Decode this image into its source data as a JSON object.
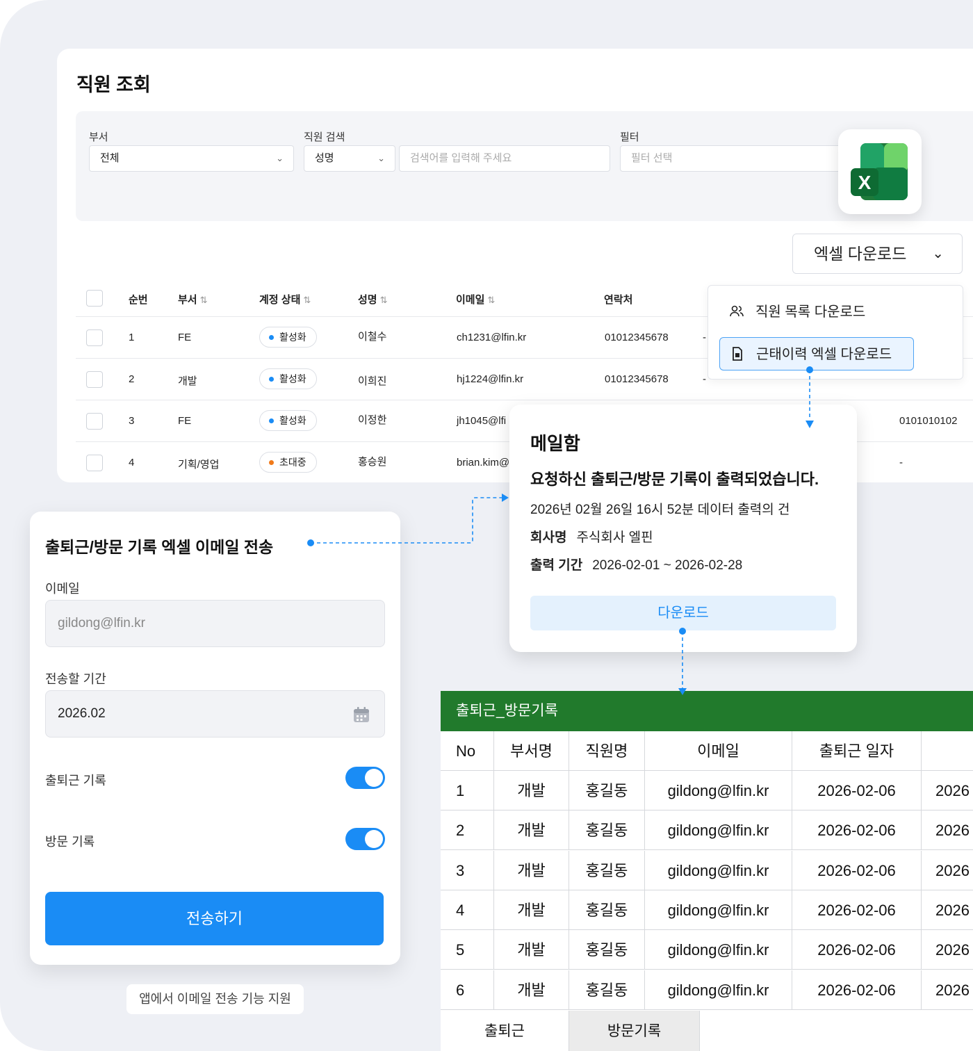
{
  "page": {
    "title": "직원 조회",
    "filters": {
      "dept_label": "부서",
      "dept_value": "전체",
      "search_label": "직원 검색",
      "search_type": "성명",
      "search_placeholder": "검색어를 입력해 주세요",
      "filter_label": "필터",
      "filter_placeholder": "필터 선택"
    },
    "excel_button": "엑셀 다운로드",
    "dropdown": {
      "items": [
        {
          "label": "직원 목록 다운로드",
          "icon": "users-icon"
        },
        {
          "label": "근태이력 엑셀 다운로드",
          "icon": "document-icon"
        }
      ]
    },
    "table": {
      "headers": {
        "no": "순번",
        "dept": "부서",
        "status": "계정 상태",
        "name": "성명",
        "email": "이메일",
        "phone": "연락처"
      },
      "rows": [
        {
          "no": "1",
          "dept": "FE",
          "status": "활성화",
          "name": "이철수",
          "email": "ch1231@lfin.kr",
          "phone": "01012345678",
          "extra": "-"
        },
        {
          "no": "2",
          "dept": "개발",
          "status": "활성화",
          "name": "이희진",
          "email": "hj1224@lfin.kr",
          "phone": "01012345678",
          "extra": "-"
        },
        {
          "no": "3",
          "dept": "FE",
          "status": "활성화",
          "name": "이정한",
          "email": "jh1045@lfi",
          "phone": "0101010102",
          "extra": ""
        },
        {
          "no": "4",
          "dept": "기획/영업",
          "status": "초대중",
          "name": "홍승원",
          "email": "brian.kim@",
          "phone": "-",
          "extra": ""
        }
      ],
      "status_colors": {
        "active": "#1a8cf5",
        "invited": "#f07a1a"
      }
    }
  },
  "send_card": {
    "title": "출퇴근/방문 기록 엑셀 이메일 전송",
    "email_label": "이메일",
    "email_value": "gildong@lfin.kr",
    "period_label": "전송할 기간",
    "period_value": "2026.02",
    "commute_label": "출퇴근 기록",
    "visit_label": "방문 기록",
    "submit": "전송하기",
    "caption": "앱에서 이메일 전송 기능 지원"
  },
  "mail": {
    "title": "메일함",
    "subject": "요청하신 출퇴근/방문 기록이 출력되었습니다.",
    "line": "2026년 02월 26일 16시 52분 데이터 출력의 건",
    "company_label": "회사명",
    "company_value": "주식회사 엘핀",
    "period_label": "출력 기간",
    "period_value": "2026-02-01 ~ 2026-02-28",
    "download": "다운로드"
  },
  "sheet": {
    "title": "출퇴근_방문기록",
    "headers": [
      "No",
      "부서명",
      "직원명",
      "이메일",
      "출퇴근 일자",
      ""
    ],
    "rows": [
      [
        "1",
        "개발",
        "홍길동",
        "gildong@lfin.kr",
        "2026-02-06",
        "2026"
      ],
      [
        "2",
        "개발",
        "홍길동",
        "gildong@lfin.kr",
        "2026-02-06",
        "2026"
      ],
      [
        "3",
        "개발",
        "홍길동",
        "gildong@lfin.kr",
        "2026-02-06",
        "2026"
      ],
      [
        "4",
        "개발",
        "홍길동",
        "gildong@lfin.kr",
        "2026-02-06",
        "2026"
      ],
      [
        "5",
        "개발",
        "홍길동",
        "gildong@lfin.kr",
        "2026-02-06",
        "2026"
      ],
      [
        "6",
        "개발",
        "홍길동",
        "gildong@lfin.kr",
        "2026-02-06",
        "2026"
      ]
    ],
    "tabs": [
      "출퇴근",
      "방문기록"
    ],
    "header_color": "#217a2c"
  }
}
